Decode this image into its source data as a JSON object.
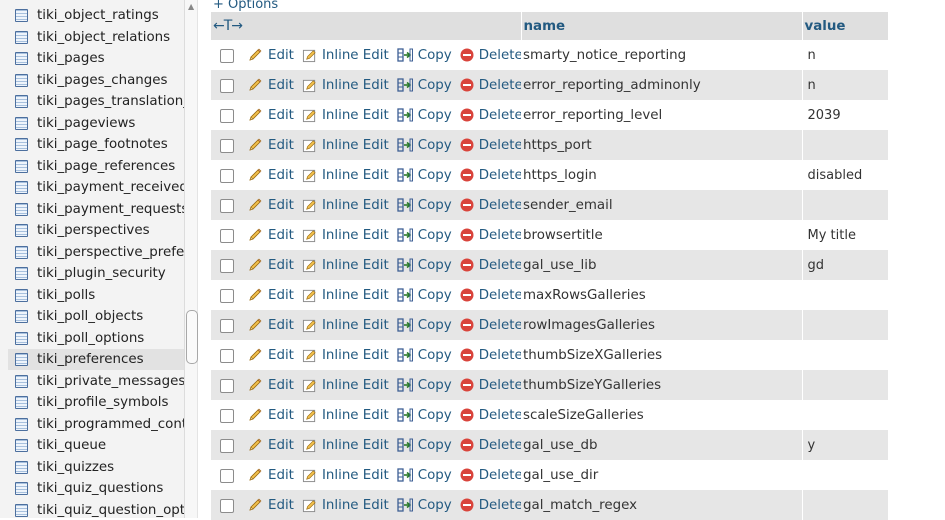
{
  "sidebar": {
    "items": [
      {
        "label": "tiki_object_ratings"
      },
      {
        "label": "tiki_object_relations"
      },
      {
        "label": "tiki_pages"
      },
      {
        "label": "tiki_pages_changes"
      },
      {
        "label": "tiki_pages_translation_"
      },
      {
        "label": "tiki_pageviews"
      },
      {
        "label": "tiki_page_footnotes"
      },
      {
        "label": "tiki_page_references"
      },
      {
        "label": "tiki_payment_received"
      },
      {
        "label": "tiki_payment_requests"
      },
      {
        "label": "tiki_perspectives"
      },
      {
        "label": "tiki_perspective_prefe"
      },
      {
        "label": "tiki_plugin_security"
      },
      {
        "label": "tiki_polls"
      },
      {
        "label": "tiki_poll_objects"
      },
      {
        "label": "tiki_poll_options"
      },
      {
        "label": "tiki_preferences",
        "active": true
      },
      {
        "label": "tiki_private_messages"
      },
      {
        "label": "tiki_profile_symbols"
      },
      {
        "label": "tiki_programmed_cont"
      },
      {
        "label": "tiki_queue"
      },
      {
        "label": "tiki_quizzes"
      },
      {
        "label": "tiki_quiz_questions"
      },
      {
        "label": "tiki_quiz_question_opt"
      }
    ]
  },
  "main": {
    "options_link": "+ Options",
    "columns": {
      "arrows": "←T→",
      "name": "name",
      "value": "value"
    },
    "actions": {
      "edit": "Edit",
      "inline_edit": "Inline Edit",
      "copy": "Copy",
      "delete": "Delete"
    },
    "rows": [
      {
        "name": "smarty_notice_reporting",
        "value": "n"
      },
      {
        "name": "error_reporting_adminonly",
        "value": "n"
      },
      {
        "name": "error_reporting_level",
        "value": "2039"
      },
      {
        "name": "https_port",
        "value": ""
      },
      {
        "name": "https_login",
        "value": "disabled"
      },
      {
        "name": "sender_email",
        "value": ""
      },
      {
        "name": "browsertitle",
        "value": "My title"
      },
      {
        "name": "gal_use_lib",
        "value": "gd"
      },
      {
        "name": "maxRowsGalleries",
        "value": ""
      },
      {
        "name": "rowImagesGalleries",
        "value": ""
      },
      {
        "name": "thumbSizeXGalleries",
        "value": ""
      },
      {
        "name": "thumbSizeYGalleries",
        "value": ""
      },
      {
        "name": "scaleSizeGalleries",
        "value": ""
      },
      {
        "name": "gal_use_db",
        "value": "y"
      },
      {
        "name": "gal_use_dir",
        "value": ""
      },
      {
        "name": "gal_match_regex",
        "value": ""
      }
    ]
  },
  "colors": {
    "link": "#235a81",
    "row_even": "#e6e6e6",
    "header_bg": "#dfdfdf",
    "delete_red": "#d9443b"
  }
}
